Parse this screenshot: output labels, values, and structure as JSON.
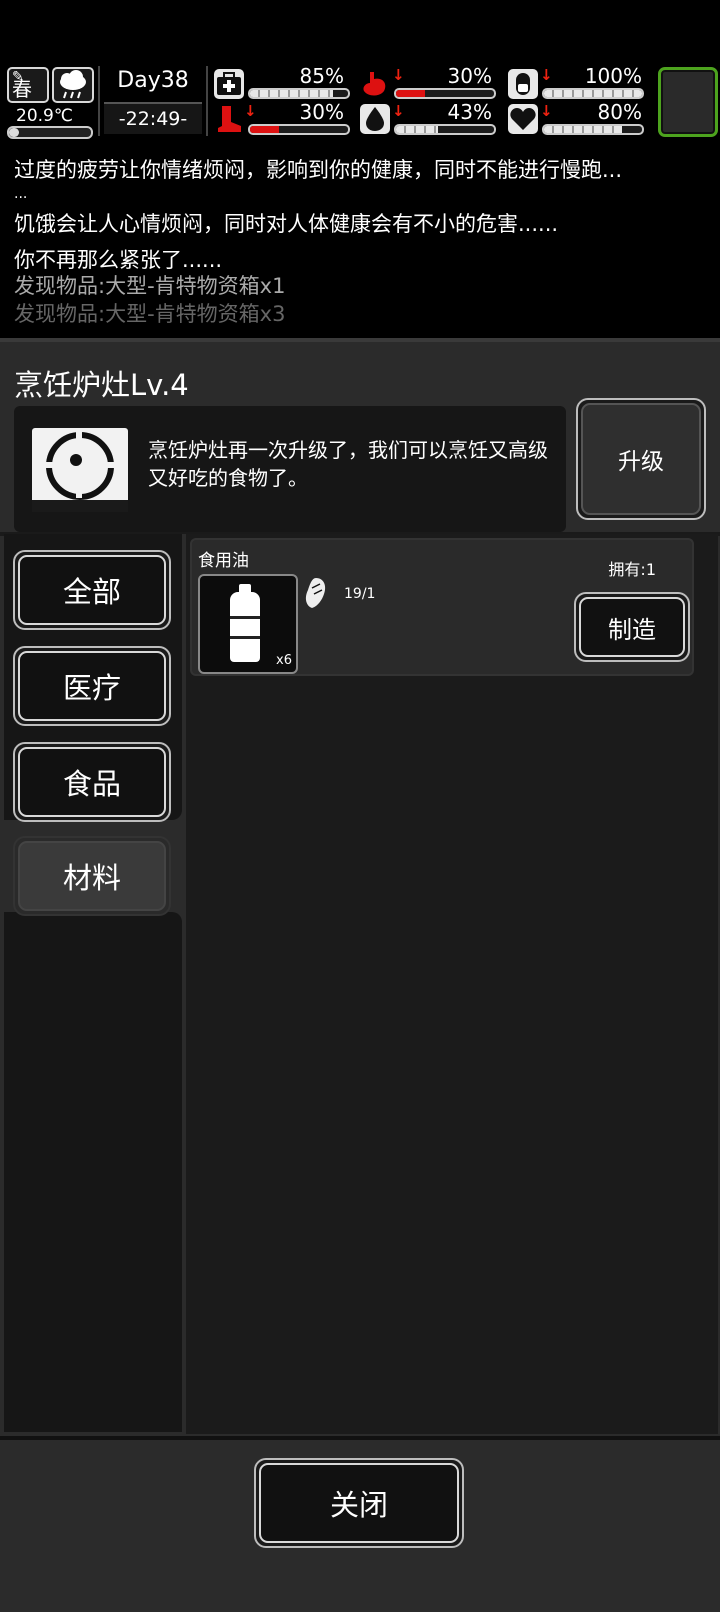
{
  "status_bar": {
    "season": "春",
    "temperature": "20.9℃",
    "temperature_level": 0.12,
    "day": "Day38",
    "time": "-22:49-",
    "stats": [
      {
        "name": "health",
        "icon": "medkit-icon",
        "value": "85%",
        "level": 0.85,
        "color": "#ffffff",
        "warning": false
      },
      {
        "name": "hunger",
        "icon": "stomach-icon",
        "value": "30%",
        "level": 0.3,
        "color": "#d11111",
        "warning": true
      },
      {
        "name": "pill",
        "icon": "pill-icon",
        "value": "100%",
        "level": 1.0,
        "color": "#ffffff",
        "warning": true
      },
      {
        "name": "stamina",
        "icon": "boot-icon",
        "value": "30%",
        "level": 0.3,
        "color": "#d11111",
        "warning": true
      },
      {
        "name": "water",
        "icon": "droplet-icon",
        "value": "43%",
        "level": 0.43,
        "color": "#ffffff",
        "warning": true
      },
      {
        "name": "mood",
        "icon": "heart-icon",
        "value": "80%",
        "level": 0.8,
        "color": "#ffffff",
        "warning": true
      }
    ]
  },
  "log": {
    "lines": [
      "过度的疲劳让你情绪烦闷，影响到你的健康，同时不能进行慢跑...",
      "...",
      "饥饿会让人心情烦闷，同时对人体健康会有不小的危害......",
      "你不再那么紧张了......",
      "发现物品:大型-肯特物资箱x1",
      "发现物品:大型-肯特物资箱x3"
    ]
  },
  "facility": {
    "title": "烹饪炉灶Lv.4",
    "description": "烹饪炉灶再一次升级了，我们可以烹饪又高级又好吃的食物了。",
    "upgrade_label": "升级"
  },
  "categories": [
    "全部",
    "医疗",
    "食品",
    "材料"
  ],
  "active_category": "材料",
  "items": [
    {
      "name": "食用油",
      "count": "x6",
      "ingredient": "19/1",
      "owned": "拥有:1",
      "make_label": "制造"
    }
  ],
  "footer": {
    "close_label": "关闭"
  }
}
